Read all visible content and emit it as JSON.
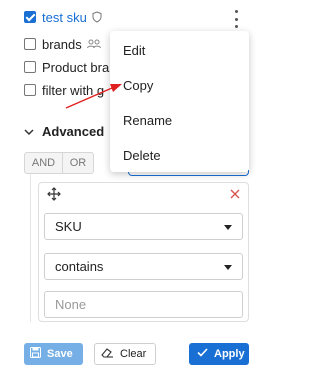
{
  "filters": [
    {
      "label": "test sku",
      "checked": true,
      "style": "link",
      "icon": "shield-icon"
    },
    {
      "label": "brands",
      "checked": false,
      "style": "normal",
      "icon": "users-icon"
    },
    {
      "label": "Product bra",
      "checked": false,
      "style": "normal"
    },
    {
      "label": "filter with g",
      "checked": false,
      "style": "normal"
    }
  ],
  "context_menu": {
    "items": [
      "Edit",
      "Copy",
      "Rename",
      "Delete"
    ]
  },
  "advanced": {
    "title": "Advanced",
    "logic": {
      "and_label": "AND",
      "or_label": "OR"
    },
    "condition": {
      "field": "SKU",
      "operator": "contains",
      "value": "",
      "value_placeholder": "None"
    }
  },
  "buttons": {
    "save_label": "Save",
    "clear_label": "Clear",
    "apply_label": "Apply"
  },
  "colors": {
    "accent": "#1a6fd4",
    "save_button": "#76aee6",
    "annotation_arrow": "#e02020",
    "remove_icon": "#d9534f"
  }
}
